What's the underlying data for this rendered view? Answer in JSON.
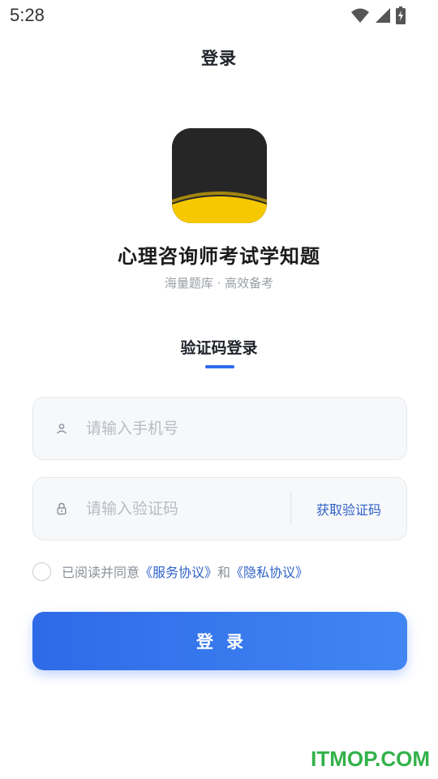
{
  "status_bar": {
    "time": "5:28",
    "icons": [
      "wifi-icon",
      "signal-icon",
      "battery-charging-icon"
    ]
  },
  "header": {
    "title": "登录"
  },
  "app": {
    "logo_text": "心理咨询师学知题",
    "name": "心理咨询师考试学知题",
    "slogan": "海量题库 · 高效备考"
  },
  "login_tab": {
    "label": "验证码登录",
    "active": true
  },
  "form": {
    "phone": {
      "icon": "user-icon",
      "value": "",
      "placeholder": "请输入手机号"
    },
    "code": {
      "icon": "lock-icon",
      "value": "",
      "placeholder": "请输入验证码",
      "get_code_label": "获取验证码"
    }
  },
  "agreement": {
    "checked": false,
    "prefix": "已阅读并同意",
    "service_link": "《服务协议》",
    "conjunction": "和",
    "privacy_link": "《隐私协议》"
  },
  "login_button": {
    "label": "登录"
  },
  "watermark": {
    "text": "ITMOP.COM"
  },
  "colors": {
    "accent": "#2f6bec",
    "link": "#2f62c8",
    "watermark": "#33b24a",
    "logo_yellow": "#f6c800"
  }
}
